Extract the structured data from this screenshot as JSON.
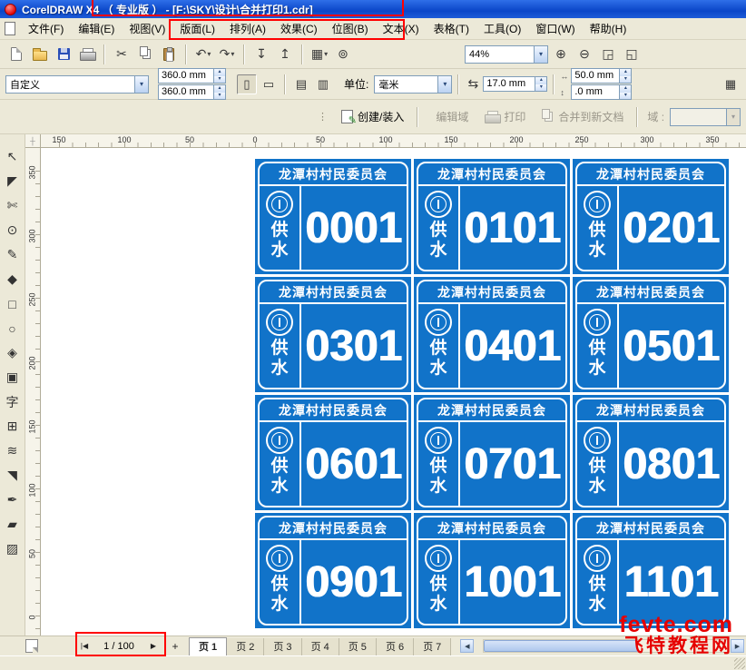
{
  "window": {
    "title": "CorelDRAW X4 （ 专业版 ） - [F:\\SKY\\设计\\合并打印1.cdr]"
  },
  "menu_bar": {
    "items": [
      "文件(F)",
      "编辑(E)",
      "视图(V)",
      "版面(L)",
      "排列(A)",
      "效果(C)",
      "位图(B)",
      "文本(X)",
      "表格(T)",
      "工具(O)",
      "窗口(W)",
      "帮助(H)"
    ]
  },
  "standard_toolbar": {
    "zoom_level": "44%"
  },
  "property_bar": {
    "preset": "自定义",
    "page_width": "360.0 mm",
    "page_height": "360.0 mm",
    "units_label": "单位:",
    "units_value": "毫米",
    "nudge_offset": "17.0 mm",
    "duplicate_x": "50.0 mm",
    "duplicate_y": ".0 mm"
  },
  "merge_toolbar": {
    "create_label": "创建/装入",
    "edit_label": "编辑域",
    "print_label": "打印",
    "merge_label": "合并到新文档",
    "field_label": "域 :"
  },
  "rulers": {
    "horizontal_labels": [
      "150",
      "100",
      "50",
      "0",
      "50",
      "100",
      "150",
      "200",
      "250",
      "300",
      "350"
    ],
    "vertical_labels": [
      "350",
      "300",
      "250",
      "200",
      "150",
      "100",
      "50",
      "0"
    ]
  },
  "toolbox": {
    "tools": [
      {
        "name": "pick-tool-icon",
        "glyph": "↖"
      },
      {
        "name": "shape-tool-icon",
        "glyph": "◤"
      },
      {
        "name": "crop-tool-icon",
        "glyph": "✄"
      },
      {
        "name": "zoom-tool-icon",
        "glyph": "⊙"
      },
      {
        "name": "freehand-tool-icon",
        "glyph": "✎"
      },
      {
        "name": "smart-fill-tool-icon",
        "glyph": "◆"
      },
      {
        "name": "rectangle-tool-icon",
        "glyph": "□"
      },
      {
        "name": "ellipse-tool-icon",
        "glyph": "○"
      },
      {
        "name": "polygon-tool-icon",
        "glyph": "◈"
      },
      {
        "name": "basic-shapes-tool-icon",
        "glyph": "▣"
      },
      {
        "name": "text-tool-icon",
        "glyph": "字"
      },
      {
        "name": "table-tool-icon",
        "glyph": "⊞"
      },
      {
        "name": "blend-tool-icon",
        "glyph": "≋"
      },
      {
        "name": "eyedropper-tool-icon",
        "glyph": "◥"
      },
      {
        "name": "outline-pen-tool-icon",
        "glyph": "✒"
      },
      {
        "name": "fill-tool-icon",
        "glyph": "▰"
      },
      {
        "name": "interactive-fill-tool-icon",
        "glyph": "▨"
      }
    ]
  },
  "document": {
    "tickets": {
      "org": "龙潭村村民委员会",
      "service": "供水",
      "numbers": [
        "0001",
        "0101",
        "0201",
        "0301",
        "0401",
        "0501",
        "0601",
        "0701",
        "0801",
        "0901",
        "1001",
        "1101"
      ]
    }
  },
  "page_nav": {
    "current": "1 / 100",
    "tabs": [
      "页 1",
      "页 2",
      "页 3",
      "页 4",
      "页 5",
      "页 6",
      "页 7"
    ]
  },
  "watermark": {
    "line1": "fevte.com",
    "line2": "飞特教程网"
  },
  "colors": {
    "ticket_blue": "#1173C9",
    "titlebar_blue": "#0A46C8",
    "highlight_red": "#FF0000",
    "toolbar_gray": "#ECE9D8"
  },
  "glyphs": {
    "cut": "✂",
    "undo": "↶",
    "redo": "↷",
    "import": "↧",
    "export": "↥",
    "launcher": "▦",
    "online": "⊚",
    "dropdown": "▾",
    "spin_up": "▴",
    "spin_down": "▾",
    "zoom_in": "⊕",
    "zoom_out": "⊖",
    "zoom_selected": "◲",
    "zoom_page": "◱",
    "portrait": "▯",
    "landscape": "▭",
    "pages_mode_a": "▤",
    "pages_mode_b": "▥",
    "nudge": "⇆",
    "dup_h": "↔",
    "dup_v": "↕",
    "options": "▦",
    "grip": "⋮",
    "nav_first": "|◀",
    "nav_next": "▶",
    "add_page": "+",
    "tab_scroll_left": "◀",
    "scroll_right": "▶",
    "ruler_origin": "┼"
  }
}
